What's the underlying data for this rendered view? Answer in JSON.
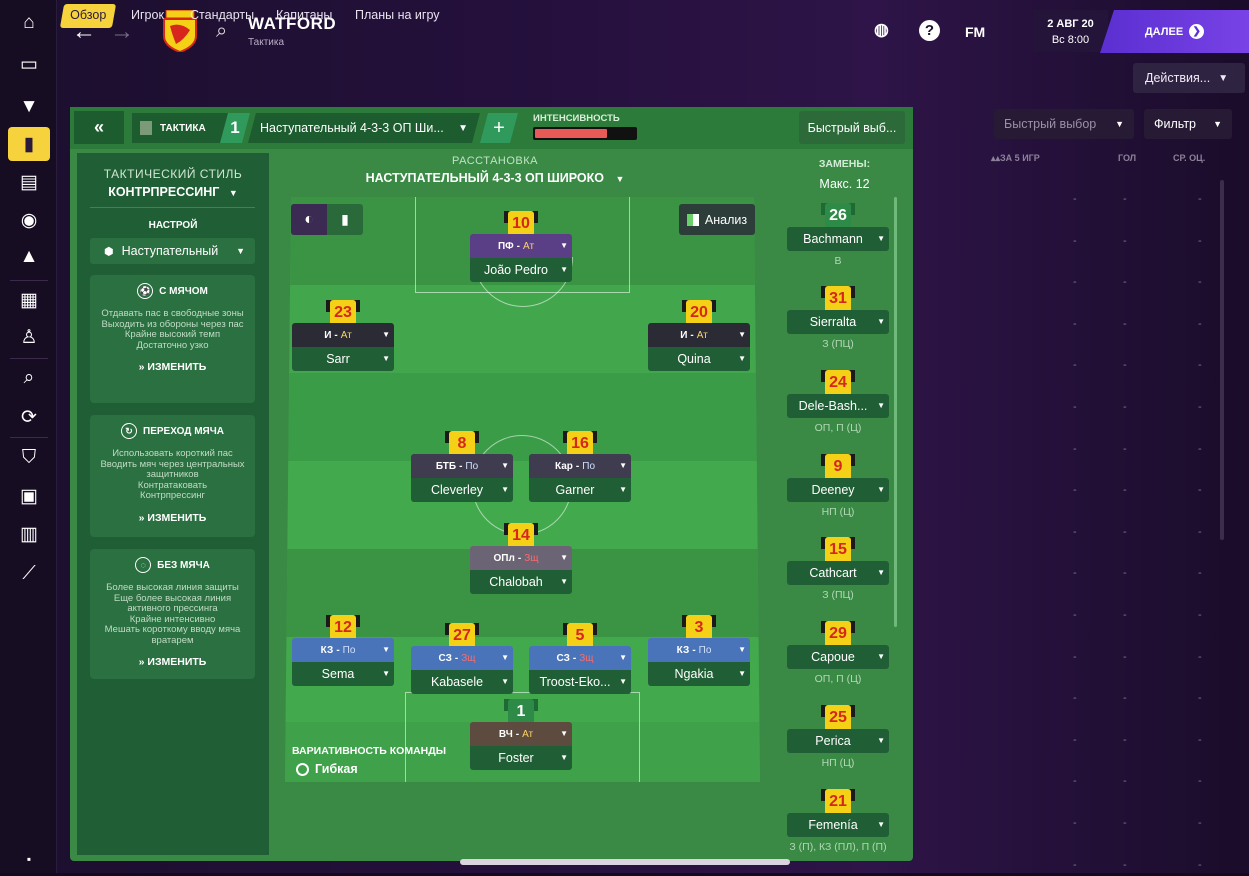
{
  "header": {
    "club_name": "WATFORD",
    "club_subtitle": "Тактика",
    "fm_label": "FM",
    "date_line1": "2 АВГ 20",
    "date_line2": "Вс 8:00",
    "next_label": "ДАЛЕЕ"
  },
  "tabs": [
    {
      "label": "Обзор"
    },
    {
      "label": "Игрок"
    },
    {
      "label": "Стандарты"
    },
    {
      "label": "Капитаны"
    },
    {
      "label": "Планы на игру"
    }
  ],
  "actions_label": "Действия...",
  "panel": {
    "tactic_tab": "ТАКТИКА",
    "slot_number": "1",
    "formation_dropdown": "Наступательный 4-3-3 ОП Ши...",
    "intensity_label": "ИНТЕНСИВНОСТЬ",
    "intensity_level": 0.72,
    "quick_pick": "Быстрый выб..."
  },
  "left": {
    "style_label": "ТАКТИЧЕСКИЙ СТИЛЬ",
    "style_value": "КОНТРПРЕССИНГ",
    "mentality_label": "НАСТРОЙ",
    "mentality_value": "Наступательный",
    "sections": [
      {
        "title": "С МЯЧОМ",
        "lines": [
          "Отдавать пас в свободные зоны",
          "Выходить из обороны через пас",
          "Крайне высокий темп",
          "Достаточно узко"
        ],
        "edit": "ИЗМЕНИТЬ"
      },
      {
        "title": "ПЕРЕХОД МЯЧА",
        "lines": [
          "Использовать короткий пас",
          "Вводить мяч через центральных защитников",
          "Контратаковать",
          "Контрпрессинг"
        ],
        "edit": "ИЗМЕНИТЬ"
      },
      {
        "title": "БЕЗ МЯЧА",
        "lines": [
          "Более высокая линия защиты",
          "Еще более высокая линия активного прессинга",
          "Крайне интенсивно",
          "Мешать короткому вводу мяча вратарем"
        ],
        "edit": "ИЗМЕНИТЬ"
      }
    ]
  },
  "center": {
    "title": "РАССТАНОВКА",
    "formation": "НАСТУПАТЕЛЬНЫЙ 4-3-3 ОП ШИРОКО",
    "analysis_label": "Анализ",
    "variability_label": "ВАРИАТИВНОСТЬ КОМАНДЫ",
    "variability_value": "Гибкая"
  },
  "players": [
    {
      "num": "10",
      "role": "ПФ",
      "duty": "Ат",
      "name": "João Pedro",
      "color": "#5a3f86"
    },
    {
      "num": "23",
      "role": "И",
      "duty": "Ат",
      "name": "Sarr",
      "color": "#2b2b35"
    },
    {
      "num": "20",
      "role": "И",
      "duty": "Ат",
      "name": "Quina",
      "color": "#2b2b35"
    },
    {
      "num": "8",
      "role": "БТБ",
      "duty": "По",
      "name": "Cleverley",
      "color": "#3e3c4e"
    },
    {
      "num": "16",
      "role": "Кар",
      "duty": "По",
      "name": "Garner",
      "color": "#3e3c4e"
    },
    {
      "num": "14",
      "role": "ОПл",
      "duty": "Зщ",
      "name": "Chalobah",
      "color": "#6b6474"
    },
    {
      "num": "12",
      "role": "КЗ",
      "duty": "По",
      "name": "Sema",
      "color": "#4a74b9"
    },
    {
      "num": "27",
      "role": "СЗ",
      "duty": "Зщ",
      "name": "Kabasele",
      "color": "#4a74b9"
    },
    {
      "num": "5",
      "role": "СЗ",
      "duty": "Зщ",
      "name": "Troost-Eko...",
      "color": "#4a74b9"
    },
    {
      "num": "3",
      "role": "КЗ",
      "duty": "По",
      "name": "Ngakia",
      "color": "#4a74b9"
    },
    {
      "num": "1",
      "role": "ВЧ",
      "duty": "Ат",
      "name": "Foster",
      "color": "#5c4b3e"
    }
  ],
  "subs": {
    "title": "ЗАМЕНЫ:",
    "max_label": "Макс. 12",
    "list": [
      {
        "num": "26",
        "name": "Bachmann",
        "pos": "В",
        "gk": true
      },
      {
        "num": "31",
        "name": "Sierralta",
        "pos": "З (ПЦ)"
      },
      {
        "num": "24",
        "name": "Dele-Bash...",
        "pos": "ОП, П (Ц)"
      },
      {
        "num": "9",
        "name": "Deeney",
        "pos": "НП (Ц)"
      },
      {
        "num": "15",
        "name": "Cathcart",
        "pos": "З (ПЦ)"
      },
      {
        "num": "29",
        "name": "Capoue",
        "pos": "ОП, П (Ц)"
      },
      {
        "num": "25",
        "name": "Perica",
        "pos": "НП (Ц)"
      },
      {
        "num": "21",
        "name": "Femenía",
        "pos": "З (П), КЗ (ПЛ), П (П)"
      }
    ]
  },
  "right": {
    "quick_pick": "Быстрый выбор",
    "filter": "Фильтр",
    "col1": "ЗА 5 ИГР",
    "col2": "ГОЛ",
    "col3": "СР. ОЦ."
  }
}
